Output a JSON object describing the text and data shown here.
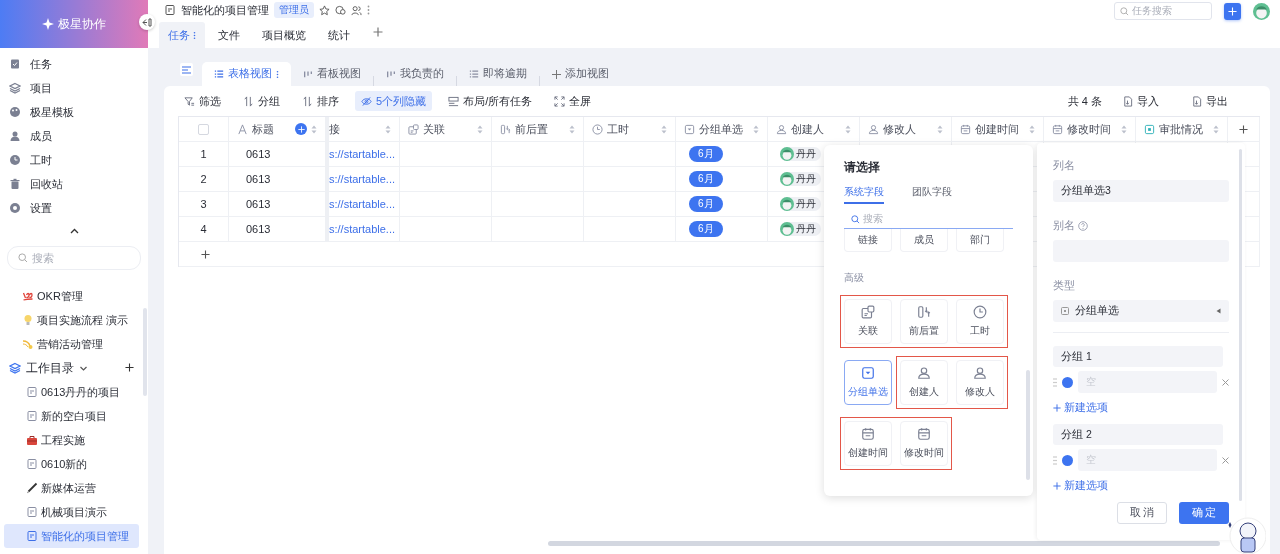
{
  "app": {
    "name": "极星协作"
  },
  "sidebar": {
    "nav": [
      {
        "label": "任务",
        "kind": "task"
      },
      {
        "label": "项目",
        "kind": "layers"
      },
      {
        "label": "极星模板",
        "kind": "palette"
      },
      {
        "label": "成员",
        "kind": "person"
      },
      {
        "label": "工时",
        "kind": "clock"
      },
      {
        "label": "回收站",
        "kind": "trash"
      },
      {
        "label": "设置",
        "kind": "gear"
      }
    ],
    "search": {
      "placeholder": "搜索"
    },
    "favorites": [
      {
        "label": "OKR管理",
        "kind": "hundred"
      },
      {
        "label": "项目实施流程 演示",
        "kind": "bulb"
      },
      {
        "label": "营销活动管理",
        "kind": "comet"
      }
    ],
    "workspace": {
      "label": "工作目录",
      "expanded": true,
      "children": [
        {
          "label": "0613丹丹的项目",
          "kind": "doc",
          "selected": false
        },
        {
          "label": "新的空白项目",
          "kind": "doc",
          "selected": false
        },
        {
          "label": "工程实施",
          "kind": "toolbox",
          "selected": false
        },
        {
          "label": "0610新的",
          "kind": "doc",
          "selected": false
        },
        {
          "label": "新媒体运营",
          "kind": "pen",
          "selected": false
        },
        {
          "label": "机械项目演示",
          "kind": "doc",
          "selected": false
        },
        {
          "label": "智能化的项目管理",
          "kind": "doc",
          "selected": true
        }
      ]
    }
  },
  "header": {
    "title": "智能化的项目管理",
    "badge": "管理员",
    "search": {
      "placeholder": "任务搜索"
    },
    "tabs": [
      {
        "label": "任务",
        "selected": true
      },
      {
        "label": "文件",
        "selected": false
      },
      {
        "label": "项目概览",
        "selected": false
      },
      {
        "label": "统计",
        "selected": false
      }
    ]
  },
  "views": {
    "tabs": [
      {
        "label": "表格视图",
        "kind": "list",
        "selected": true
      },
      {
        "label": "看板视图",
        "kind": "board",
        "selected": false
      },
      {
        "label": "我负责的",
        "kind": "board",
        "selected": false
      },
      {
        "label": "即将逾期",
        "kind": "list",
        "selected": false
      }
    ],
    "add": "添加视图"
  },
  "toolbar": {
    "items": [
      {
        "label": "筛选",
        "kind": "filter",
        "selected": false
      },
      {
        "label": "分组",
        "kind": "sort",
        "selected": false
      },
      {
        "label": "排序",
        "kind": "sort",
        "selected": false
      },
      {
        "label": "5个列隐藏",
        "kind": "hide",
        "selected": true
      },
      {
        "label": "布局/所有任务",
        "kind": "layout",
        "selected": false
      },
      {
        "label": "全屏",
        "kind": "full",
        "selected": false
      }
    ],
    "count": "共 4 条",
    "import": "导入",
    "export": "导出"
  },
  "table": {
    "select_all": {
      "checked": false
    },
    "columns": [
      {
        "label": "标题",
        "kind": "text"
      },
      {
        "label": "接",
        "kind": "link"
      },
      {
        "label": "关联",
        "kind": "relation"
      },
      {
        "label": "前后置",
        "kind": "dependency"
      },
      {
        "label": "工时",
        "kind": "time"
      },
      {
        "label": "分组单选",
        "kind": "select"
      },
      {
        "label": "创建人",
        "kind": "person"
      },
      {
        "label": "修改人",
        "kind": "person"
      },
      {
        "label": "创建时间",
        "kind": "date"
      },
      {
        "label": "修改时间",
        "kind": "date"
      },
      {
        "label": "审批情况",
        "kind": "approval"
      }
    ],
    "rows": [
      {
        "index": "1",
        "title": "0613",
        "link": "s://startable...",
        "group": "6月",
        "creator": "丹丹"
      },
      {
        "index": "2",
        "title": "0613",
        "link": "s://startable...",
        "group": "6月",
        "creator": "丹丹"
      },
      {
        "index": "3",
        "title": "0613",
        "link": "s://startable...",
        "group": "6月",
        "creator": "丹丹"
      },
      {
        "index": "4",
        "title": "0613",
        "link": "s://startable...",
        "group": "6月",
        "creator": "丹丹"
      }
    ]
  },
  "picker": {
    "title": "请选择",
    "tabs": [
      {
        "label": "系统字段",
        "selected": true
      },
      {
        "label": "团队字段",
        "selected": false
      }
    ],
    "search": {
      "placeholder": "搜索"
    },
    "basic": [
      "链接",
      "成员",
      "部门"
    ],
    "section": "高级",
    "groups": [
      {
        "outlined": true,
        "options": [
          {
            "label": "关联",
            "kind": "relation",
            "selected": false
          },
          {
            "label": "前后置",
            "kind": "dependency",
            "selected": false
          },
          {
            "label": "工时",
            "kind": "time",
            "selected": false
          }
        ]
      },
      {
        "outlined": false,
        "options": [
          {
            "label": "分组单选",
            "kind": "select",
            "selected": true
          }
        ]
      },
      {
        "outlined": true,
        "options": [
          {
            "label": "创建人",
            "kind": "person",
            "selected": false
          },
          {
            "label": "修改人",
            "kind": "person",
            "selected": false
          }
        ]
      },
      {
        "outlined": true,
        "options": [
          {
            "label": "创建时间",
            "kind": "date",
            "selected": false
          },
          {
            "label": "修改时间",
            "kind": "date",
            "selected": false
          }
        ]
      }
    ]
  },
  "editor": {
    "name_label": "列名",
    "name_value": "分组单选3",
    "alias_label": "别名",
    "type_label": "类型",
    "type_value": "分组单选",
    "groups": [
      {
        "name": "分组 1",
        "options": [
          {
            "placeholder": "空",
            "color": "#3d74f0"
          }
        ],
        "add": "新建选项"
      },
      {
        "name": "分组 2",
        "options": [
          {
            "placeholder": "空",
            "color": "#3d74f0"
          }
        ],
        "add": "新建选项"
      }
    ],
    "cancel": "取 消",
    "confirm": "确 定"
  }
}
